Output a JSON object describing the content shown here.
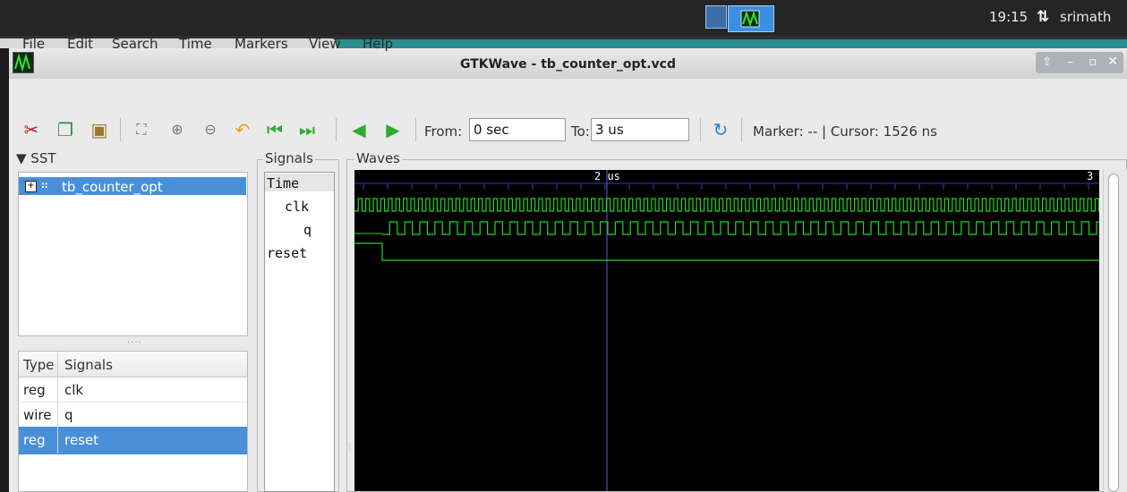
{
  "desktop": {
    "clock": "19:15",
    "user": "srimath",
    "net_icon": "network-transfer-icon",
    "taskbar": [
      "terminal-window-icon",
      "gtkwave-window-icon"
    ]
  },
  "window": {
    "title": "GTKWave - tb_counter_opt.vcd",
    "buttons": [
      "maximize-up-icon",
      "minimize-icon",
      "restore-icon",
      "close-icon"
    ]
  },
  "menu": [
    "File",
    "Edit",
    "Search",
    "Time",
    "Markers",
    "View",
    "Help"
  ],
  "toolbar": {
    "icons": [
      "cut-icon",
      "copy-icon",
      "paste-icon",
      "zoom-fit-icon",
      "zoom-in-icon",
      "zoom-out-icon",
      "undo-zoom-icon",
      "zoom-start-icon",
      "zoom-end-icon",
      "prev-edge-icon",
      "next-edge-icon",
      "reload-icon"
    ],
    "from_label": "From:",
    "from_value": "0 sec",
    "to_label": "To:",
    "to_value": "3 us",
    "marker": "Marker: --  |  Cursor: 1526 ns"
  },
  "sst": {
    "label": "▼ SST",
    "tree": [
      {
        "label": "tb_counter_opt",
        "expander": "+",
        "selected": true
      }
    ],
    "table": {
      "headers": [
        "Type",
        "Signals"
      ],
      "rows": [
        {
          "type": "reg",
          "signal": "clk",
          "selected": false
        },
        {
          "type": "wire",
          "signal": "q",
          "selected": false
        },
        {
          "type": "reg",
          "signal": "reset",
          "selected": true
        }
      ]
    }
  },
  "signals_pane": {
    "label": "Signals",
    "names": [
      "Time",
      "clk",
      "q",
      "reset"
    ]
  },
  "waves_pane": {
    "label": "Waves",
    "time_labels": [
      "2 us",
      "3"
    ],
    "colors": {
      "background": "#000000",
      "trace": "#21d821",
      "grid": "#3a3ab8",
      "cursor": "#5a5adc"
    }
  }
}
